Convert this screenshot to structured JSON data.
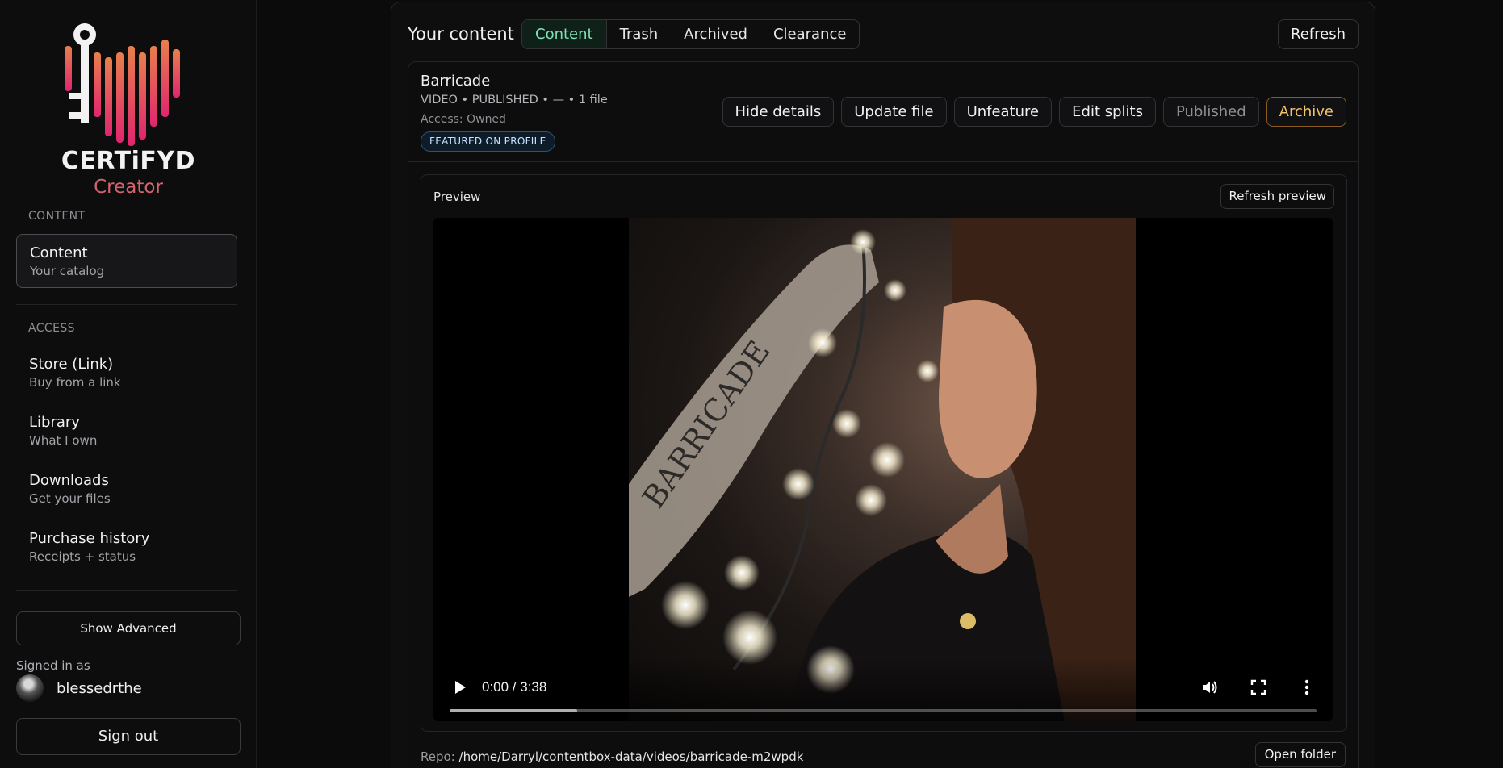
{
  "brand": {
    "name": "CERTiFYD",
    "sub": "Creator",
    "colors": {
      "gradient_top": "#e8804c",
      "gradient_bottom": "#e0256f"
    }
  },
  "sidebar": {
    "content_section": "CONTENT",
    "content_item": {
      "title": "Content",
      "sub": "Your catalog"
    },
    "access_section": "ACCESS",
    "access_items": [
      {
        "title": "Store (Link)",
        "sub": "Buy from a link"
      },
      {
        "title": "Library",
        "sub": "What I own"
      },
      {
        "title": "Downloads",
        "sub": "Get your files"
      },
      {
        "title": "Purchase history",
        "sub": "Receipts + status"
      }
    ],
    "show_advanced": "Show Advanced",
    "signed_in_label": "Signed in as",
    "username": "blessedrthe",
    "sign_out": "Sign out"
  },
  "main": {
    "title": "Your content",
    "tabs": [
      "Content",
      "Trash",
      "Archived",
      "Clearance"
    ],
    "active_tab": "Content",
    "refresh": "Refresh"
  },
  "item": {
    "title": "Barricade",
    "meta": "VIDEO • PUBLISHED • — • 1 file",
    "access": "Access: Owned",
    "badge": "FEATURED ON PROFILE",
    "actions": [
      "Hide details",
      "Update file",
      "Unfeature",
      "Edit splits",
      "Published",
      "Archive"
    ]
  },
  "preview": {
    "label": "Preview",
    "refresh_preview": "Refresh preview",
    "time": "0:00 / 3:38",
    "progress_fraction": 0.147,
    "cover_text": "BARRICADE"
  },
  "repo": {
    "label": "Repo:",
    "path": "/home/Darryl/contentbox-data/videos/barricade-m2wpdk",
    "open_folder": "Open folder"
  }
}
